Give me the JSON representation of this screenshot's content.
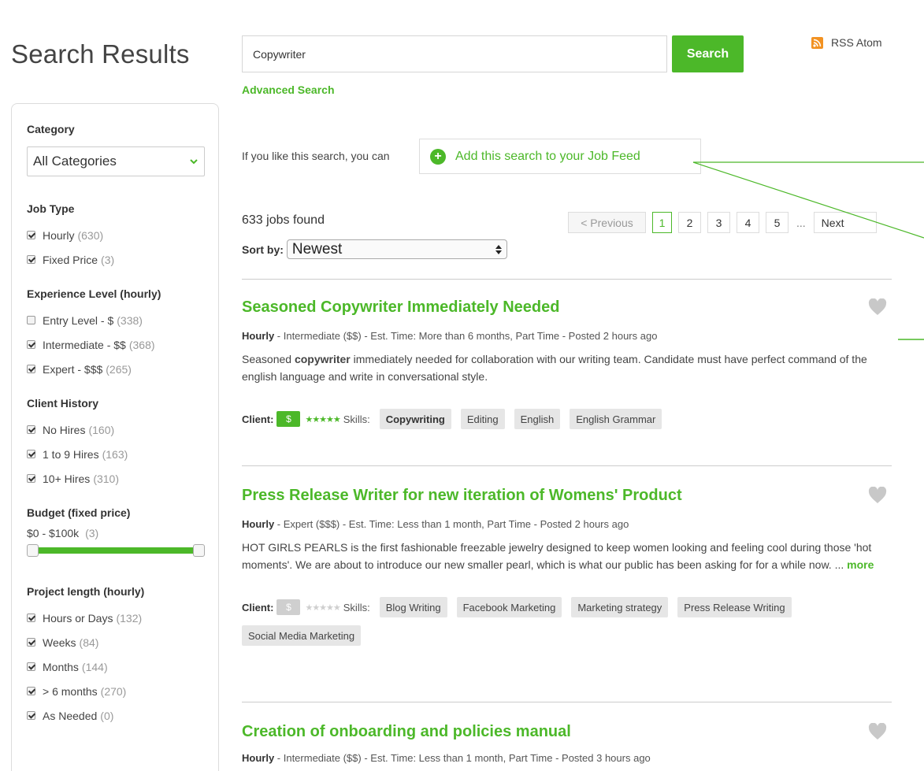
{
  "page": {
    "title": "Search Results"
  },
  "search": {
    "value": "Copywriter",
    "button_label": "Search",
    "advanced_label": "Advanced Search",
    "rss_label": "RSS Atom"
  },
  "feed": {
    "prompt": "If you like this search, you can",
    "button_label": "Add this search to your Job Feed"
  },
  "results": {
    "count_label": "633 jobs found",
    "sort_label": "Sort by:",
    "sort_value": "Newest"
  },
  "pager": {
    "prev_label": "< Previous",
    "pages": [
      "1",
      "2",
      "3",
      "4",
      "5"
    ],
    "active_page": "1",
    "ellipsis": "...",
    "next_label": "Next"
  },
  "sidebar": {
    "category": {
      "title": "Category",
      "value": "All Categories"
    },
    "job_type": {
      "title": "Job Type",
      "items": [
        {
          "label": "Hourly",
          "count": "(630)",
          "checked": true
        },
        {
          "label": "Fixed Price",
          "count": "(3)",
          "checked": true
        }
      ]
    },
    "experience": {
      "title": "Experience Level (hourly)",
      "items": [
        {
          "label": "Entry Level - $",
          "count": "(338)",
          "checked": false
        },
        {
          "label": "Intermediate - $$",
          "count": "(368)",
          "checked": true
        },
        {
          "label": "Expert - $$$",
          "count": "(265)",
          "checked": true
        }
      ]
    },
    "client_history": {
      "title": "Client History",
      "items": [
        {
          "label": "No Hires",
          "count": "(160)",
          "checked": true
        },
        {
          "label": "1 to 9 Hires",
          "count": "(163)",
          "checked": true
        },
        {
          "label": "10+ Hires",
          "count": "(310)",
          "checked": true
        }
      ]
    },
    "budget": {
      "title": "Budget (fixed price)",
      "range_label": "$0 - $100k",
      "count": "(3)",
      "range_min_fraction": 0.0,
      "range_max_fraction": 1.0
    },
    "project_length": {
      "title": "Project length (hourly)",
      "items": [
        {
          "label": "Hours or Days",
          "count": "(132)",
          "checked": true
        },
        {
          "label": "Weeks",
          "count": "(84)",
          "checked": true
        },
        {
          "label": "Months",
          "count": "(144)",
          "checked": true
        },
        {
          "label": "> 6 months",
          "count": "(270)",
          "checked": true
        },
        {
          "label": "As Needed",
          "count": "(0)",
          "checked": true
        }
      ]
    }
  },
  "jobs": [
    {
      "title": "Seasoned Copywriter Immediately Needed",
      "meta_type": "Hourly",
      "meta_rest": " - Intermediate ($$) - Est. Time: More than 6 months, Part Time - Posted 2 hours ago",
      "desc_pre": "Seasoned ",
      "desc_bold": "copywriter",
      "desc_post": " immediately needed for collaboration with our writing team. Candidate must have perfect command of the english language and write in conversational style.",
      "more_label": "",
      "client_label": "Client:",
      "client_money": "$",
      "client_verified": true,
      "stars": "★★★★★",
      "skills_label": "Skills:",
      "skills": [
        "Copywriting",
        "Editing",
        "English",
        "English Grammar"
      ]
    },
    {
      "title": "Press Release Writer for new iteration of Womens' Product",
      "meta_type": "Hourly",
      "meta_rest": " - Expert ($$$) - Est. Time: Less than 1 month, Part Time - Posted 2 hours ago",
      "desc_pre": "HOT GIRLS PEARLS is the first fashionable freezable jewelry designed to keep women looking and feeling cool during those 'hot moments'.  We are about to introduce our new smaller pearl, which is what our public has been asking for for a while now. ... ",
      "desc_bold": "",
      "desc_post": "",
      "more_label": "more",
      "client_label": "Client:",
      "client_money": "$",
      "client_verified": false,
      "stars": "★★★★★",
      "skills_label": "Skills:",
      "skills": [
        "Blog Writing",
        "Facebook Marketing",
        "Marketing strategy",
        "Press Release Writing",
        "Social Media Marketing"
      ]
    },
    {
      "title": "Creation of onboarding and policies manual",
      "meta_type": "Hourly",
      "meta_rest": " - Intermediate ($$) - Est. Time: Less than 1 month, Part Time - Posted 3 hours ago"
    }
  ],
  "colors": {
    "accent": "#4cb829",
    "rss": "#f29222",
    "tag_bg": "#e6e6e6"
  }
}
